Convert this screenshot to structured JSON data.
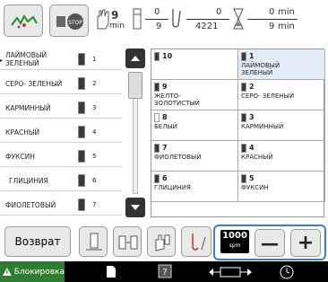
{
  "header": {
    "stitch_min": "9",
    "stitch_min_unit": "min",
    "color_count_top": "0",
    "color_count_bottom": "9",
    "stitch_count_top": "0",
    "stitch_count_bottom": "4221",
    "time_top": "0",
    "time_top_unit": "min",
    "time_bottom": "9",
    "time_bottom_unit": "min"
  },
  "threads": [
    {
      "label": "ЛАЙМОВЫЙ\nЗЕЛЕНЫЙ",
      "num": "1",
      "active": true
    },
    {
      "label": "СЕРО- ЗЕЛЕНЫЙ",
      "num": "2"
    },
    {
      "label": "КАРМИННЫЙ",
      "num": "3"
    },
    {
      "label": "КРАСНЫЙ",
      "num": "4"
    },
    {
      "label": "ФУКСИН",
      "num": "5"
    },
    {
      "label": "ГЛИЦИНИЯ",
      "num": "6"
    },
    {
      "label": "ФИОЛЕТОВЫЙ",
      "num": "7"
    }
  ],
  "needles": [
    {
      "num": "10",
      "color": ""
    },
    {
      "num": "1",
      "color": "ЛАЙМОВЫЙ\nЗЕЛЕНЫЙ",
      "highlight": true
    },
    {
      "num": "9",
      "color": "ЖЕЛТО-\nЗОЛОТИСТЫЙ"
    },
    {
      "num": "2",
      "color": "СЕРО- ЗЕЛЕНЫЙ"
    },
    {
      "num": "8",
      "color": "БЕЛЫЙ"
    },
    {
      "num": "3",
      "color": "КАРМИННЫЙ"
    },
    {
      "num": "7",
      "color": "ФИОЛЕТОВЫЙ"
    },
    {
      "num": "4",
      "color": "КРАСНЫЙ"
    },
    {
      "num": "6",
      "color": "ГЛИЦИНИЯ"
    },
    {
      "num": "5",
      "color": "ФУКСИН"
    }
  ],
  "bottom": {
    "back_label": "Возврат",
    "speed_value": "1000",
    "speed_unit": "spm",
    "minus": "—",
    "plus": "+"
  },
  "status": {
    "lock_label": "Блокировка"
  },
  "colors": {
    "highlight": "#3a7bd5",
    "status_bg": "#000000"
  }
}
